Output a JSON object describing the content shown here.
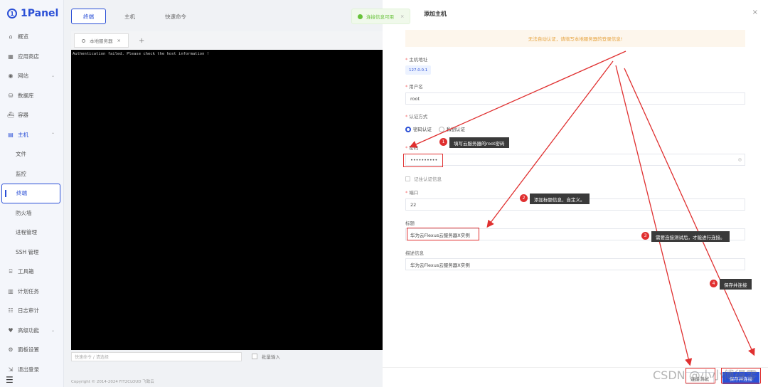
{
  "app": {
    "logo_text": "1Panel",
    "logo_mark": "1"
  },
  "sidebar": {
    "items": [
      {
        "icon": "⌂",
        "label": "概览"
      },
      {
        "icon": "▦",
        "label": "应用商店"
      },
      {
        "icon": "◉",
        "label": "网站",
        "arrow": "⌄"
      },
      {
        "icon": "⛁",
        "label": "数据库"
      },
      {
        "icon": "⛴",
        "label": "容器"
      },
      {
        "icon": "▤",
        "label": "主机",
        "arrow": "⌃"
      }
    ],
    "host_sub": [
      {
        "label": "文件"
      },
      {
        "label": "监控"
      },
      {
        "label": "终端"
      },
      {
        "label": "防火墙"
      },
      {
        "label": "进程管理"
      },
      {
        "label": "SSH 管理"
      }
    ],
    "bottom_items": [
      {
        "icon": "⌸",
        "label": "工具箱"
      },
      {
        "icon": "▥",
        "label": "计划任务"
      },
      {
        "icon": "☷",
        "label": "日志审计"
      },
      {
        "icon": "♥",
        "label": "高级功能",
        "arrow": "⌄"
      },
      {
        "icon": "⚙",
        "label": "面板设置"
      },
      {
        "icon": "⇲",
        "label": "退出登录"
      }
    ],
    "footer_icon": "☰"
  },
  "main": {
    "tabs": [
      "终端",
      "主机",
      "快速命令"
    ],
    "term_tab": "本地服务器",
    "term_tab_close": "×",
    "term_add": "+",
    "terminal_text": "Authentication failed. Please check the host information !",
    "cmd_placeholder": "快速命令 / 请选择",
    "batch_label": "批量输入",
    "copyright": "Copyright © 2014-2024 FIT2CLOUD 飞致云"
  },
  "toast": {
    "text": "连接信息可用",
    "close": "×"
  },
  "drawer": {
    "title": "添加主机",
    "close": "×",
    "warning": "无法自动认证，请填写本地服务器的登录信息!",
    "host_label": "主机地址",
    "host_value": "127.0.0.1",
    "user_label": "用户名",
    "user_value": "root",
    "auth_label": "认证方式",
    "auth_options": [
      "密码认证",
      "私钥认证"
    ],
    "password_label": "密码",
    "password_value": "••••••••••",
    "eye_icon": "◎",
    "remember_label": "记住认证信息",
    "port_label": "端口",
    "port_value": "22",
    "title_label": "标题",
    "title_value": "华为云Flexus云服务器X实例",
    "desc_label": "描述信息",
    "desc_value": "华为云Flexus云服务器X实例",
    "test_button": "连接测试",
    "save_button": "保存并连接"
  },
  "annotations": [
    {
      "num": "1",
      "text": "填写云服务器的root密码"
    },
    {
      "num": "2",
      "text": "添加标题信息，自定义。"
    },
    {
      "num": "3",
      "text": "需要连接测试后，才能进行连接。"
    },
    {
      "num": "4",
      "text": "保存并连接"
    }
  ],
  "watermark": "CSDN @小小傅得零",
  "colors": {
    "accent": "#2a4fd6",
    "annotation_red": "#e03030",
    "warning_text": "#e6a23c",
    "success": "#67c23a"
  }
}
